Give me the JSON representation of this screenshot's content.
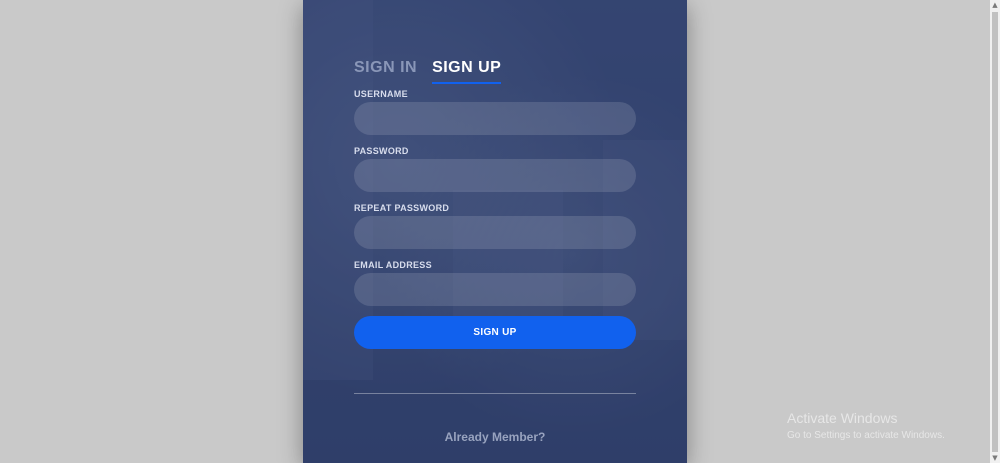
{
  "tabs": [
    {
      "label": "SIGN IN",
      "active": false
    },
    {
      "label": "SIGN UP",
      "active": true
    }
  ],
  "form": {
    "username": {
      "label": "USERNAME",
      "value": ""
    },
    "password": {
      "label": "PASSWORD",
      "value": ""
    },
    "repeat_password": {
      "label": "REPEAT PASSWORD",
      "value": ""
    },
    "email": {
      "label": "EMAIL ADDRESS",
      "value": ""
    },
    "submit_label": "SIGN UP"
  },
  "footer": {
    "member_link": "Already Member?"
  },
  "watermark": {
    "title": "Activate Windows",
    "subtitle": "Go to Settings to activate Windows."
  },
  "colors": {
    "accent": "#1161ee",
    "card": "#3f4e78",
    "page_bg": "#c9c9c9"
  },
  "icons": {
    "scroll_up": "scroll-up-arrow-icon",
    "scroll_down": "scroll-down-arrow-icon"
  }
}
